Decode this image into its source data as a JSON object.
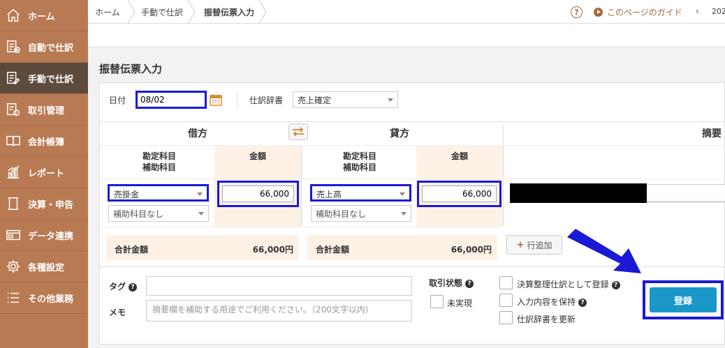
{
  "sidebar": {
    "items": [
      {
        "label": "ホーム",
        "icon": "home-icon",
        "active": false
      },
      {
        "label": "自動で仕訳",
        "icon": "auto-journal-icon",
        "active": false
      },
      {
        "label": "手動で仕訳",
        "icon": "manual-journal-icon",
        "active": true
      },
      {
        "label": "取引管理",
        "icon": "transaction-icon",
        "active": false
      },
      {
        "label": "会計帳簿",
        "icon": "ledger-book-icon",
        "active": false
      },
      {
        "label": "レポート",
        "icon": "report-chart-icon",
        "active": false
      },
      {
        "label": "決算・申告",
        "icon": "filing-icon",
        "active": false
      },
      {
        "label": "データ連携",
        "icon": "data-link-icon",
        "active": false
      },
      {
        "label": "各種設定",
        "icon": "gear-icon",
        "active": false
      },
      {
        "label": "その他業務",
        "icon": "list-icon",
        "active": false
      }
    ]
  },
  "topbar": {
    "breadcrumb": [
      "ホーム",
      "手動で仕訳",
      "振替伝票入力"
    ],
    "help_mark": "?",
    "guide_label": "このページのガイド",
    "prev_arrow": "‹",
    "year_partial": "202"
  },
  "page": {
    "title": "振替伝票入力"
  },
  "form": {
    "date_label": "日付",
    "date_value": "08/02",
    "dictionary_label": "仕訳辞書",
    "dictionary_value": "売上確定",
    "debit_header": "借方",
    "credit_header": "貸方",
    "memo_header": "摘要",
    "account_header_line1": "勘定科目",
    "account_header_line2": "補助科目",
    "amount_header": "金額",
    "debit_account": "売掛金",
    "debit_sub_account": "補助科目なし",
    "debit_amount": "66,000",
    "credit_account": "売上高",
    "credit_sub_account": "補助科目なし",
    "credit_amount": "66,000",
    "total_label": "合計金額",
    "debit_total": "66,000円",
    "credit_total": "66,000円",
    "add_row_label": "行追加",
    "tag_label": "タグ",
    "memo_label": "メモ",
    "memo_placeholder": "摘要欄を補助する用途でご利用ください。（200文字以内）",
    "status_label": "取引状態",
    "unrealized_label": "未実現",
    "closing_entry_label": "決算整理仕訳として登録",
    "keep_input_label": "入力内容を保持",
    "update_dictionary_label": "仕訳辞書を更新",
    "register_label": "登録"
  },
  "colors": {
    "sidebar_bg": "#b87a52",
    "sidebar_active": "#5c4a3c",
    "accent": "#a6683e",
    "highlight_box": "#1a1ad6",
    "register_button": "#1a96c9",
    "amount_column_bg": "#fdf1e6"
  }
}
